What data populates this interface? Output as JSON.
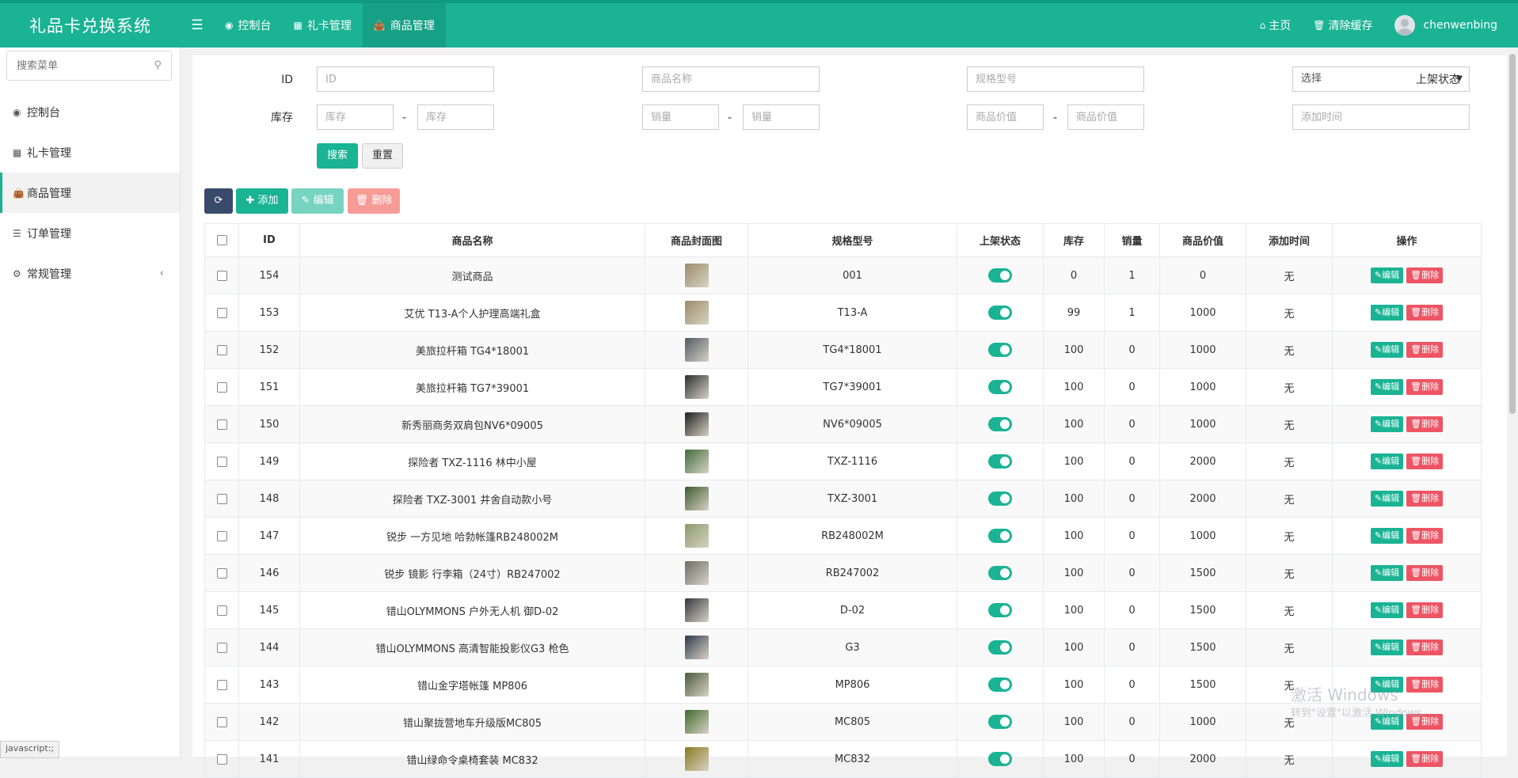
{
  "app": {
    "title": "礼品卡兑换系统"
  },
  "topnav": {
    "items": [
      {
        "label": "控制台",
        "icon": "dashboard-icon"
      },
      {
        "label": "礼卡管理",
        "icon": "grid-icon"
      },
      {
        "label": "商品管理",
        "icon": "shopping-bag-icon"
      }
    ],
    "home": "主页",
    "clear_cache": "清除缓存",
    "user": "chenwenbing"
  },
  "sidebar": {
    "search_placeholder": "搜索菜单",
    "items": [
      {
        "label": "控制台",
        "icon": "dashboard-icon"
      },
      {
        "label": "礼卡管理",
        "icon": "grid-icon"
      },
      {
        "label": "商品管理",
        "icon": "shopping-bag-icon"
      },
      {
        "label": "订单管理",
        "icon": "list-icon"
      },
      {
        "label": "常规管理",
        "icon": "cogs-icon"
      }
    ]
  },
  "filters": {
    "id_label": "ID",
    "id_placeholder": "ID",
    "name_label": "商品名称",
    "name_placeholder": "商品名称",
    "spec_label": "规格型号",
    "spec_placeholder": "规格型号",
    "status_label": "上架状态",
    "status_value": "选择",
    "stock_label": "库存",
    "stock_placeholder": "库存",
    "sales_label": "销量",
    "sales_placeholder": "销量",
    "value_label": "商品价值",
    "value_placeholder": "商品价值",
    "time_label": "添加时间",
    "time_placeholder": "添加时间",
    "dash": "-",
    "search_btn": "搜索",
    "reset_btn": "重置"
  },
  "toolbar": {
    "add": "添加",
    "edit": "编辑",
    "delete": "删除"
  },
  "table": {
    "headers": [
      "ID",
      "商品名称",
      "商品封面图",
      "规格型号",
      "上架状态",
      "库存",
      "销量",
      "商品价值",
      "添加时间",
      "操作"
    ],
    "edit_label": "编辑",
    "delete_label": "删除",
    "rows": [
      {
        "id": "154",
        "name": "测试商品",
        "spec": "001",
        "stock": "0",
        "sales": "1",
        "value": "0",
        "time": "无",
        "thumb": "#9b8c6b"
      },
      {
        "id": "153",
        "name": "艾优 T13-A个人护理高端礼盒",
        "spec": "T13-A",
        "stock": "99",
        "sales": "1",
        "value": "1000",
        "time": "无",
        "thumb": "#9b8c6b"
      },
      {
        "id": "152",
        "name": "美旅拉杆箱 TG4*18001",
        "spec": "TG4*18001",
        "stock": "100",
        "sales": "0",
        "value": "1000",
        "time": "无",
        "thumb": "#505a64"
      },
      {
        "id": "151",
        "name": "美旅拉杆箱 TG7*39001",
        "spec": "TG7*39001",
        "stock": "100",
        "sales": "0",
        "value": "1000",
        "time": "无",
        "thumb": "#2a2d30"
      },
      {
        "id": "150",
        "name": "新秀丽商务双肩包NV6*09005",
        "spec": "NV6*09005",
        "stock": "100",
        "sales": "0",
        "value": "1000",
        "time": "无",
        "thumb": "#1e1e1e"
      },
      {
        "id": "149",
        "name": "探险者 TXZ-1116 林中小屋",
        "spec": "TXZ-1116",
        "stock": "100",
        "sales": "0",
        "value": "2000",
        "time": "无",
        "thumb": "#3f6b3a"
      },
      {
        "id": "148",
        "name": "探险者 TXZ-3001 井舍自动款小号",
        "spec": "TXZ-3001",
        "stock": "100",
        "sales": "0",
        "value": "2000",
        "time": "无",
        "thumb": "#3d5a2e"
      },
      {
        "id": "147",
        "name": "锐步 一方见地 哈勃帐篷RB248002M",
        "spec": "RB248002M",
        "stock": "100",
        "sales": "0",
        "value": "1000",
        "time": "无",
        "thumb": "#8a9a6a"
      },
      {
        "id": "146",
        "name": "锐步 镜影 行李箱（24寸）RB247002",
        "spec": "RB247002",
        "stock": "100",
        "sales": "0",
        "value": "1500",
        "time": "无",
        "thumb": "#6b6e66"
      },
      {
        "id": "145",
        "name": "错山OLYMMONS 户外无人机 御D-02",
        "spec": "D-02",
        "stock": "100",
        "sales": "0",
        "value": "1500",
        "time": "无",
        "thumb": "#333740"
      },
      {
        "id": "144",
        "name": "错山OLYMMONS 高清智能投影仪G3 枪色",
        "spec": "G3",
        "stock": "100",
        "sales": "0",
        "value": "1500",
        "time": "无",
        "thumb": "#2e3a4e"
      },
      {
        "id": "143",
        "name": "错山金字塔帐篷 MP806",
        "spec": "MP806",
        "stock": "100",
        "sales": "0",
        "value": "1500",
        "time": "无",
        "thumb": "#4a5a3e"
      },
      {
        "id": "142",
        "name": "错山聚拢营地车升级版MC805",
        "spec": "MC805",
        "stock": "100",
        "sales": "0",
        "value": "1000",
        "time": "无",
        "thumb": "#3e6a2e"
      },
      {
        "id": "141",
        "name": "错山绿命令桌椅套装 MC832",
        "spec": "MC832",
        "stock": "100",
        "sales": "0",
        "value": "2000",
        "time": "无",
        "thumb": "#8a7a20"
      }
    ]
  },
  "watermark": {
    "line1": "激活 Windows",
    "line2": "转到\"设置\"以激活 Windows。"
  },
  "statusbar": "javascript:;"
}
